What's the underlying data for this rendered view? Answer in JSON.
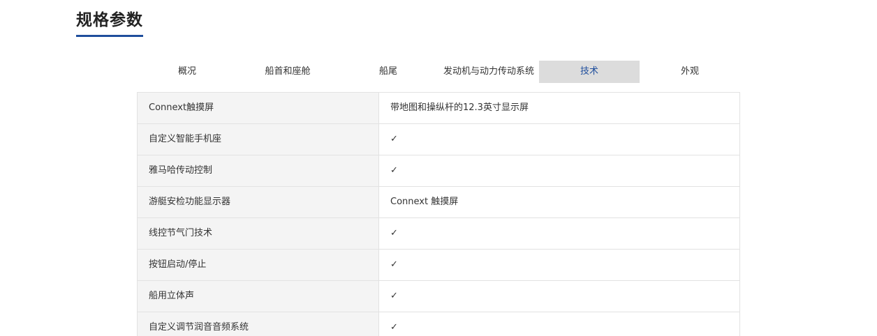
{
  "page_title": "规格参数",
  "tabs": [
    {
      "label": "概况"
    },
    {
      "label": "船首和座舱"
    },
    {
      "label": "船尾"
    },
    {
      "label": "发动机与动力传动系统"
    },
    {
      "label": "技术",
      "active": true
    },
    {
      "label": "外观"
    }
  ],
  "specs": [
    {
      "label": "Connext触摸屏",
      "value": "带地图和操纵杆的12.3英寸显示屏"
    },
    {
      "label": "自定义智能手机座",
      "value": "✓"
    },
    {
      "label": "雅马哈传动控制",
      "value": "✓"
    },
    {
      "label": "游艇安检功能显示器",
      "value": "Connext 触摸屏"
    },
    {
      "label": "线控节气门技术",
      "value": "✓"
    },
    {
      "label": "按钮启动/停止",
      "value": "✓"
    },
    {
      "label": "船用立体声",
      "value": "✓"
    },
    {
      "label": "自定义调节润音音频系统",
      "value": "✓"
    }
  ],
  "colors": {
    "accent": "#1f4e9c",
    "active_tab_bg": "#dcdcdc",
    "label_cell_bg": "#f4f4f4",
    "border": "#e2e2e2"
  }
}
